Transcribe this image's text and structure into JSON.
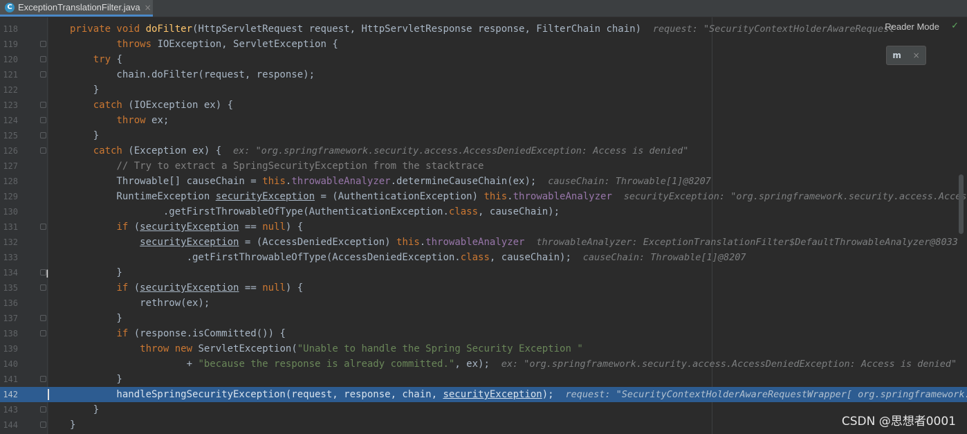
{
  "tab": {
    "icon_letter": "C",
    "label": "ExceptionTranslationFilter.java",
    "close": "×"
  },
  "toolbar": {
    "reader_mode": "Reader Mode",
    "check_icon": "check-icon"
  },
  "plugin": {
    "logo": "m",
    "close": "×"
  },
  "watermark": "CSDN @思想者0001",
  "lines": [
    {
      "n": "118",
      "parts": [
        [
          "kw",
          "private void "
        ],
        [
          "fn",
          "doFilter"
        ],
        [
          "",
          "(HttpServletRequest request, HttpServletResponse response, FilterChain chain)  "
        ],
        [
          "hint",
          "request: \"SecurityContextHolderAwareRequest"
        ]
      ]
    },
    {
      "n": "119",
      "parts": [
        [
          "",
          "        "
        ],
        [
          "kw",
          "throws "
        ],
        [
          "",
          "IOException, ServletException {"
        ]
      ]
    },
    {
      "n": "120",
      "parts": [
        [
          "",
          "    "
        ],
        [
          "kw",
          "try "
        ],
        [
          "",
          "{"
        ]
      ]
    },
    {
      "n": "121",
      "parts": [
        [
          "",
          "        chain.doFilter(request, response);"
        ]
      ]
    },
    {
      "n": "122",
      "parts": [
        [
          "",
          "    }"
        ]
      ]
    },
    {
      "n": "123",
      "parts": [
        [
          "",
          "    "
        ],
        [
          "kw",
          "catch "
        ],
        [
          "",
          "(IOException ex) {"
        ]
      ]
    },
    {
      "n": "124",
      "parts": [
        [
          "",
          "        "
        ],
        [
          "kw",
          "throw "
        ],
        [
          "",
          "ex;"
        ]
      ]
    },
    {
      "n": "125",
      "parts": [
        [
          "",
          "    }"
        ]
      ]
    },
    {
      "n": "126",
      "parts": [
        [
          "",
          "    "
        ],
        [
          "kw",
          "catch "
        ],
        [
          "",
          "(Exception ex) {  "
        ],
        [
          "hint",
          "ex: \"org.springframework.security.access.AccessDeniedException: Access is denied\""
        ]
      ]
    },
    {
      "n": "127",
      "parts": [
        [
          "",
          "        "
        ],
        [
          "cmt",
          "// Try to extract a SpringSecurityException from the stacktrace"
        ]
      ]
    },
    {
      "n": "128",
      "parts": [
        [
          "",
          "        Throwable[] causeChain = "
        ],
        [
          "kw",
          "this"
        ],
        [
          "",
          "."
        ],
        [
          "fld",
          "throwableAnalyzer"
        ],
        [
          "",
          ".determineCauseChain(ex);  "
        ],
        [
          "hint",
          "causeChain: Throwable[1]@8207"
        ]
      ]
    },
    {
      "n": "129",
      "parts": [
        [
          "",
          "        RuntimeException "
        ],
        [
          "ul",
          "securityException"
        ],
        [
          "",
          " = (AuthenticationException) "
        ],
        [
          "kw",
          "this"
        ],
        [
          "",
          "."
        ],
        [
          "fld",
          "throwableAnalyzer"
        ],
        [
          "",
          "  "
        ],
        [
          "hint",
          "securityException: \"org.springframework.security.access.AccessDeni"
        ]
      ]
    },
    {
      "n": "130",
      "parts": [
        [
          "",
          "                .getFirstThrowableOfType(AuthenticationException."
        ],
        [
          "kw",
          "class"
        ],
        [
          "",
          ", causeChain);"
        ]
      ]
    },
    {
      "n": "131",
      "parts": [
        [
          "",
          "        "
        ],
        [
          "kw",
          "if "
        ],
        [
          "",
          "("
        ],
        [
          "ul",
          "securityException"
        ],
        [
          "",
          " == "
        ],
        [
          "kw",
          "null"
        ],
        [
          "",
          ") {"
        ]
      ]
    },
    {
      "n": "132",
      "parts": [
        [
          "",
          "            "
        ],
        [
          "ul",
          "securityException"
        ],
        [
          "",
          " = (AccessDeniedException) "
        ],
        [
          "kw",
          "this"
        ],
        [
          "",
          "."
        ],
        [
          "fld",
          "throwableAnalyzer"
        ],
        [
          "",
          "  "
        ],
        [
          "hint",
          "throwableAnalyzer: ExceptionTranslationFilter$DefaultThrowableAnalyzer@8033"
        ]
      ]
    },
    {
      "n": "133",
      "parts": [
        [
          "",
          "                    .getFirstThrowableOfType(AccessDeniedException."
        ],
        [
          "kw",
          "class"
        ],
        [
          "",
          ", causeChain);  "
        ],
        [
          "hint",
          "causeChain: Throwable[1]@8207"
        ]
      ]
    },
    {
      "n": "134",
      "parts": [
        [
          "",
          "        }"
        ]
      ]
    },
    {
      "n": "135",
      "parts": [
        [
          "",
          "        "
        ],
        [
          "kw",
          "if "
        ],
        [
          "",
          "("
        ],
        [
          "ul",
          "securityException"
        ],
        [
          "",
          " == "
        ],
        [
          "kw",
          "null"
        ],
        [
          "",
          ") {"
        ]
      ]
    },
    {
      "n": "136",
      "parts": [
        [
          "",
          "            rethrow(ex);"
        ]
      ]
    },
    {
      "n": "137",
      "parts": [
        [
          "",
          "        }"
        ]
      ]
    },
    {
      "n": "138",
      "parts": [
        [
          "",
          "        "
        ],
        [
          "kw",
          "if "
        ],
        [
          "",
          "(response.isCommitted()) {"
        ]
      ]
    },
    {
      "n": "139",
      "parts": [
        [
          "",
          "            "
        ],
        [
          "kw",
          "throw new "
        ],
        [
          "",
          "ServletException("
        ],
        [
          "str",
          "\"Unable to handle the Spring Security Exception \""
        ]
      ]
    },
    {
      "n": "140",
      "parts": [
        [
          "",
          "                    + "
        ],
        [
          "str",
          "\"because the response is already committed.\""
        ],
        [
          "",
          ", ex);  "
        ],
        [
          "hint",
          "ex: \"org.springframework.security.access.AccessDeniedException: Access is denied\""
        ]
      ]
    },
    {
      "n": "141",
      "parts": [
        [
          "",
          "        }"
        ]
      ]
    },
    {
      "n": "142",
      "highlight": true,
      "parts": [
        [
          "",
          "        handleSpringSecurityException(request, response, chain, "
        ],
        [
          "ul",
          "securityException"
        ],
        [
          "",
          ");  "
        ],
        [
          "hint",
          "request: \"SecurityContextHolderAwareRequestWrapper[ org.springframework.secu"
        ]
      ]
    },
    {
      "n": "143",
      "parts": [
        [
          "",
          "    }"
        ]
      ]
    },
    {
      "n": "144",
      "parts": [
        [
          "",
          "}"
        ]
      ]
    }
  ]
}
